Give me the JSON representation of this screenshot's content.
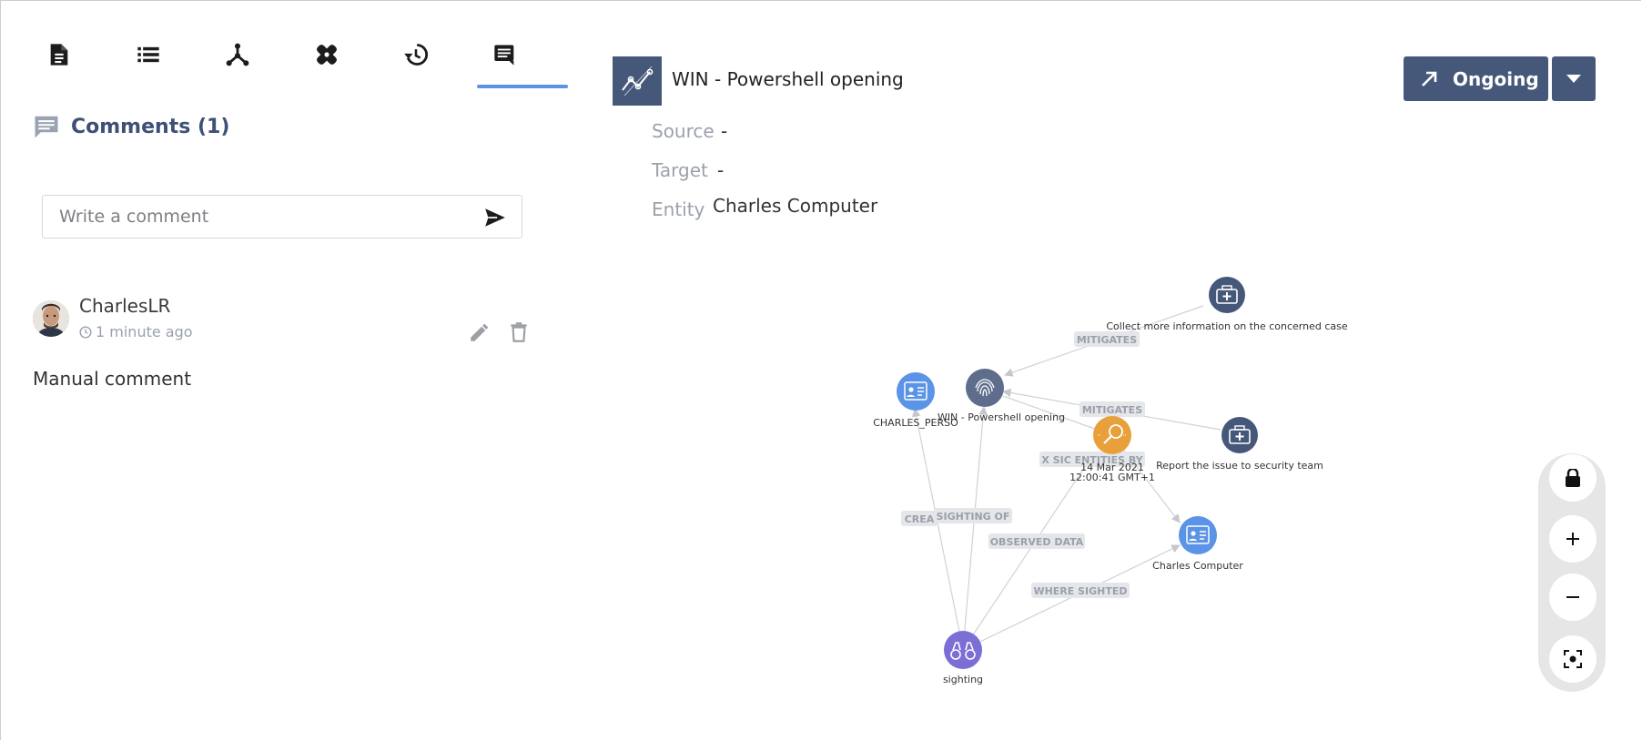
{
  "comments": {
    "title": "Comments (1)",
    "input_placeholder": "Write a comment",
    "items": [
      {
        "author": "CharlesLR",
        "time": "1 minute ago",
        "text": "Manual comment"
      }
    ]
  },
  "header": {
    "title": "WIN - Powershell opening",
    "status_label": "Ongoing"
  },
  "fields": {
    "source": {
      "label": "Source",
      "value": "-"
    },
    "target": {
      "label": "Target",
      "value": "-"
    },
    "entity": {
      "label": "Entity",
      "value": "Charles Computer"
    }
  },
  "graph": {
    "nodes": {
      "collect": "Collect more information on the concerned case",
      "win": "WIN - Powershell opening",
      "charles_perso": "CHARLES_PERSO",
      "date_line1": "14 Mar 2021",
      "date_line2": "12:00:41 GMT+1",
      "report": "Report the issue to security team",
      "charles_computer": "Charles Computer",
      "sighting": "sighting"
    },
    "edges": {
      "mitigates_1": "MITIGATES",
      "mitigates_2": "MITIGATES",
      "x_sic": "X SIC ENTITIES BY",
      "crea": "CREA",
      "sighting_of": "SIGHTING OF",
      "observed_data": "OBSERVED DATA",
      "where_sighted": "WHERE SIGHTED"
    }
  },
  "colors": {
    "primary": "#46587a",
    "accent": "#5b93e6",
    "observable": "#e8a03a",
    "sighting": "#7b6fd6",
    "identity": "#5b93e6"
  },
  "icons": [
    "file-icon",
    "list-icon",
    "graph-icon",
    "bandage-icon",
    "history-icon",
    "comments-icon",
    "send-icon",
    "clock-icon",
    "edit-icon",
    "delete-icon",
    "arrow-up-right-icon",
    "caret-down-icon",
    "lock-icon",
    "zoom-in-icon",
    "zoom-out-icon",
    "fit-icon"
  ]
}
